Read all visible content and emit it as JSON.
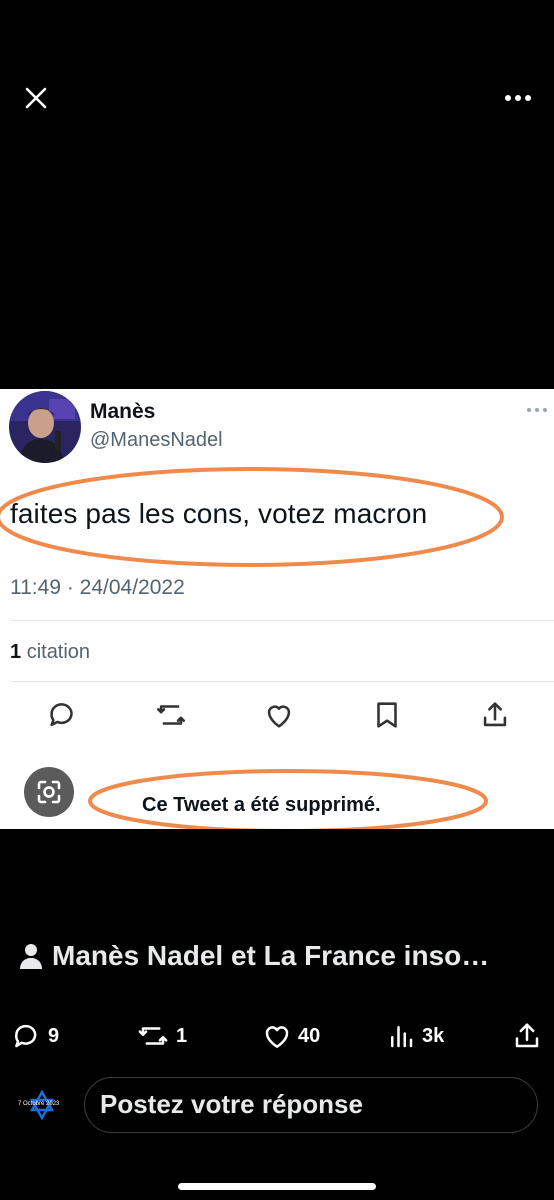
{
  "top_bar": {
    "close_icon": "close-icon",
    "more_icon": "more-horizontal-icon"
  },
  "embedded_tweet": {
    "author_name": "Manès",
    "author_handle": "@ManesNadel",
    "text": "faites pas les cons, votez macron",
    "timestamp": "11:49 · 24/04/2022",
    "quote_count": "1",
    "quote_label": "citation",
    "deleted_notice": "Ce Tweet a été supprimé.",
    "highlight_color": "#f08a4b",
    "actions": [
      "reply-icon",
      "retweet-icon",
      "like-icon",
      "bookmark-icon",
      "share-icon"
    ]
  },
  "post": {
    "title": "Manès Nadel et La France inso…",
    "stats": {
      "replies": "9",
      "reposts": "1",
      "likes": "40",
      "views": "3k"
    }
  },
  "composer": {
    "badge_text": "7 Octobre 2023",
    "placeholder": "Postez votre réponse"
  },
  "colors": {
    "background": "#000000",
    "accent_orange": "#f08a4b",
    "star_blue": "#1d6fe0"
  }
}
